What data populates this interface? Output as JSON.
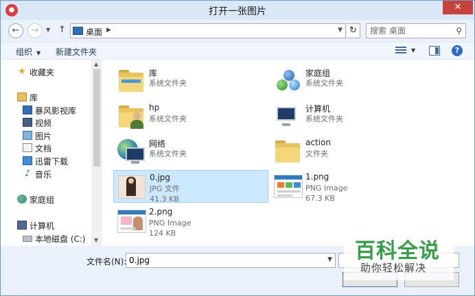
{
  "window": {
    "title": "打开一张图片"
  },
  "address": {
    "current": "桌面",
    "search_placeholder": "搜索 桌面"
  },
  "toolbar": {
    "organize": "组织",
    "new_folder": "新建文件夹"
  },
  "nav": {
    "favorites": "收藏夹",
    "libraries": "库",
    "library_items": [
      "暴风影视库",
      "视频",
      "图片",
      "文档",
      "迅雷下载",
      "音乐"
    ],
    "homegroup": "家庭组",
    "computer": "计算机",
    "local_disk": "本地磁盘 (C:)"
  },
  "items": [
    {
      "name": "库",
      "line1": "系统文件夹",
      "line2": ""
    },
    {
      "name": "家庭组",
      "line1": "系统文件夹",
      "line2": ""
    },
    {
      "name": "hp",
      "line1": "系统文件夹",
      "line2": ""
    },
    {
      "name": "计算机",
      "line1": "系统文件夹",
      "line2": ""
    },
    {
      "name": "网络",
      "line1": "系统文件夹",
      "line2": ""
    },
    {
      "name": "action",
      "line1": "文件夹",
      "line2": ""
    },
    {
      "name": "0.jpg",
      "line1": "JPG 文件",
      "line2": "41.3 KB"
    },
    {
      "name": "1.png",
      "line1": "PNG Image",
      "line2": "67.3 KB"
    },
    {
      "name": "2.png",
      "line1": "PNG Image",
      "line2": "124 KB"
    }
  ],
  "bottom": {
    "filename_label": "文件名(N):",
    "filename_value": "0.jpg"
  },
  "watermark": {
    "title": "百科全说",
    "subtitle": "助你轻松解决"
  }
}
